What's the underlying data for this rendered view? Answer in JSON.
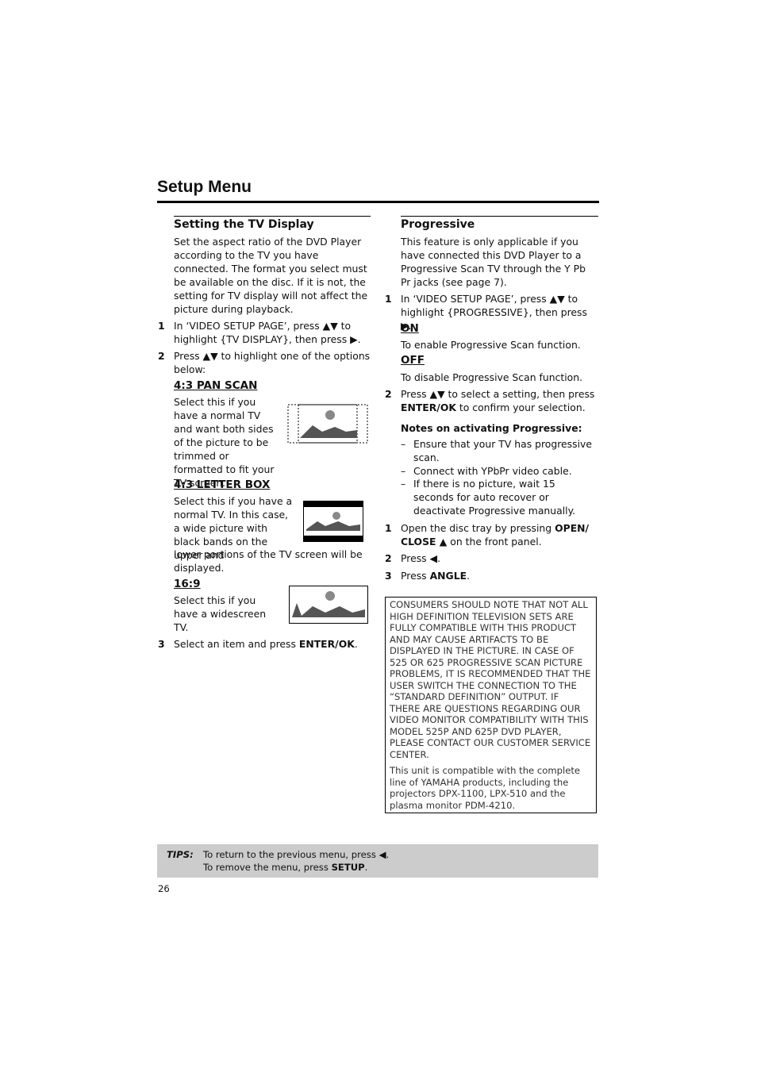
{
  "page_title": "Setup Menu",
  "left": {
    "heading": "Setting the TV Display",
    "intro": "Set the aspect ratio of the DVD Player according to the TV you have connected. The format you select must be available on the disc. If it is not, the setting for TV display will not affect the picture during playback.",
    "step1_num": "1",
    "step1": "In ‘VIDEO SETUP PAGE’, press ▲▼ to highlight {TV DISPLAY}, then press ▶.",
    "step2_num": "2",
    "step2": "Press ▲▼ to highlight one of the options below:",
    "options": [
      {
        "title": "4:3 PAN SCAN",
        "text": "Select this if you have a normal TV and want both sides of the picture to be trimmed or formatted to fit your TV screen."
      },
      {
        "title": "4:3 LETTER BOX",
        "text": "Select this if you have a normal TV. In this case, a wide picture with black bands on the upper and",
        "text2": "lower portions of the TV screen will be displayed."
      },
      {
        "title": "16:9",
        "text": "Select this if you have a widescreen TV."
      }
    ],
    "step3_num": "3",
    "step3_pre": "Select an item and press ",
    "step3_bold": "ENTER/OK",
    "step3_post": "."
  },
  "right": {
    "heading": "Progressive",
    "intro": "This feature is only applicable if you have connected this DVD Player to a Progressive Scan TV through the Y Pb Pr jacks (see page 7).",
    "step1_num": "1",
    "step1": "In ‘VIDEO SETUP PAGE’, press ▲▼ to highlight {PROGRESSIVE}, then press ▶.",
    "on_title": "ON",
    "on_text": "To enable Progressive Scan function.",
    "off_title": "OFF",
    "off_text": "To disable Progressive Scan function.",
    "step2_num": "2",
    "step2_pre": "Press ▲▼ to select a setting, then press ",
    "step2_bold": "ENTER/OK",
    "step2_post": " to confirm your selection.",
    "notes_heading": "Notes on activating Progressive:",
    "notes": [
      "Ensure that your TV has progressive scan.",
      "Connect with YPbPr video cable.",
      "If there is no picture, wait 15 seconds for auto recover or deactivate Progressive manually."
    ],
    "n1_num": "1",
    "n1_pre": "Open the disc tray by pressing ",
    "n1_bold": "OPEN/ CLOSE ▲",
    "n1_post": " on the front panel.",
    "n2_num": "2",
    "n2": "Press ◀.",
    "n3_num": "3",
    "n3_pre": "Press ",
    "n3_bold": "ANGLE",
    "n3_post": ".",
    "notice": "CONSUMERS SHOULD NOTE THAT NOT ALL HIGH DEFINITION TELEVISION SETS ARE FULLY COMPATIBLE WITH THIS PRODUCT AND MAY CAUSE ARTIFACTS TO BE DISPLAYED IN THE PICTURE. IN CASE OF 525 OR 625 PROGRESSIVE SCAN PICTURE PROBLEMS, IT IS RECOMMENDED THAT THE USER SWITCH THE CONNECTION TO THE “STANDARD DEFINITION” OUTPUT. IF THERE ARE QUESTIONS REGARDING OUR VIDEO MONITOR COMPATIBILITY WITH THIS MODEL 525P AND 625P DVD PLAYER, PLEASE CONTACT OUR CUSTOMER SERVICE CENTER.",
    "compat": "This unit is compatible with the complete line of YAMAHA products, including the projectors DPX-1100, LPX-510 and the plasma monitor PDM-4210."
  },
  "tips": {
    "label": "TIPS:",
    "line1": "To return to the previous menu, press ◀.",
    "line2_pre": "To remove the menu, press ",
    "line2_bold": "SETUP",
    "line2_post": "."
  },
  "page_number": "26"
}
